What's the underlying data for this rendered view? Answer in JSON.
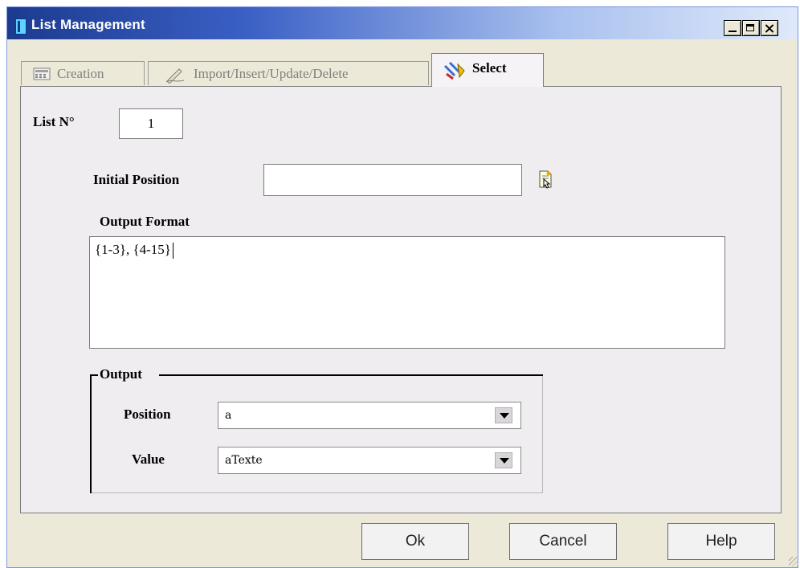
{
  "window": {
    "title": "List Management"
  },
  "tabs": [
    {
      "label": "Creation",
      "icon": "calculator-icon",
      "active": false
    },
    {
      "label": "Import/Insert/Update/Delete",
      "icon": "pen-icon",
      "active": false
    },
    {
      "label": "Select",
      "icon": "select-tools-icon",
      "active": true
    }
  ],
  "select_tab": {
    "list_no_label": "List N°",
    "list_no_value": "1",
    "initial_position_label": "Initial Position",
    "initial_position_value": "",
    "output_format_label": "Output Format",
    "output_format_value": "{1-3}, {4-15}",
    "output_group_label": "Output",
    "position_label": "Position",
    "position_value": "a",
    "value_label": "Value",
    "value_value": "aTexte"
  },
  "buttons": {
    "ok": "Ok",
    "cancel": "Cancel",
    "help": "Help"
  },
  "colors": {
    "titlebar_start": "#1c3b8f",
    "window_bg": "#ece9d8",
    "panel_bg": "#f0edf0"
  }
}
